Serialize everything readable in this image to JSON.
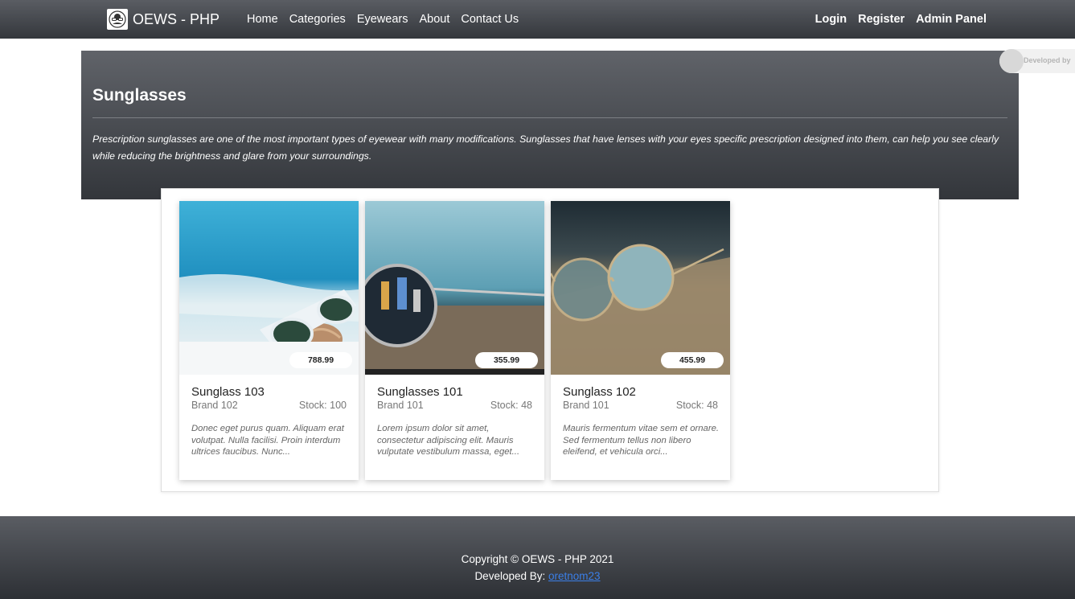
{
  "navbar": {
    "brand": "OEWS - PHP",
    "links": [
      "Home",
      "Categories",
      "Eyewears",
      "About",
      "Contact Us"
    ],
    "right_links": [
      "Login",
      "Register",
      "Admin Panel"
    ]
  },
  "hero": {
    "title": "Sunglasses",
    "description": "Prescription sunglasses are one of the most important types of eyewear with many modifications. Sunglasses that have lenses with your eyes specific prescription designed into them, can help you see clearly while reducing the brightness and glare from your surroundings."
  },
  "side_tab": {
    "label": "Developed by"
  },
  "products": [
    {
      "name": "Sunglass 103",
      "brand": "Brand 102",
      "stock": "Stock: 100",
      "price": "788.99",
      "description": "Donec eget purus quam. Aliquam erat volutpat. Nulla facilisi. Proin interdum ultrices faucibus. Nunc..."
    },
    {
      "name": "Sunglasses 101",
      "brand": "Brand 101",
      "stock": "Stock: 48",
      "price": "355.99",
      "description": "Lorem ipsum dolor sit amet, consectetur adipiscing elit. Mauris vulputate vestibulum massa, eget..."
    },
    {
      "name": "Sunglass 102",
      "brand": "Brand 101",
      "stock": "Stock: 48",
      "price": "455.99",
      "description": "Mauris fermentum vitae sem et ornare. Sed fermentum tellus non libero eleifend, et vehicula orci..."
    }
  ],
  "footer": {
    "copyright": "Copyright © OEWS - PHP 2021",
    "developed_by_label": "Developed By:",
    "developer": "oretnom23"
  }
}
